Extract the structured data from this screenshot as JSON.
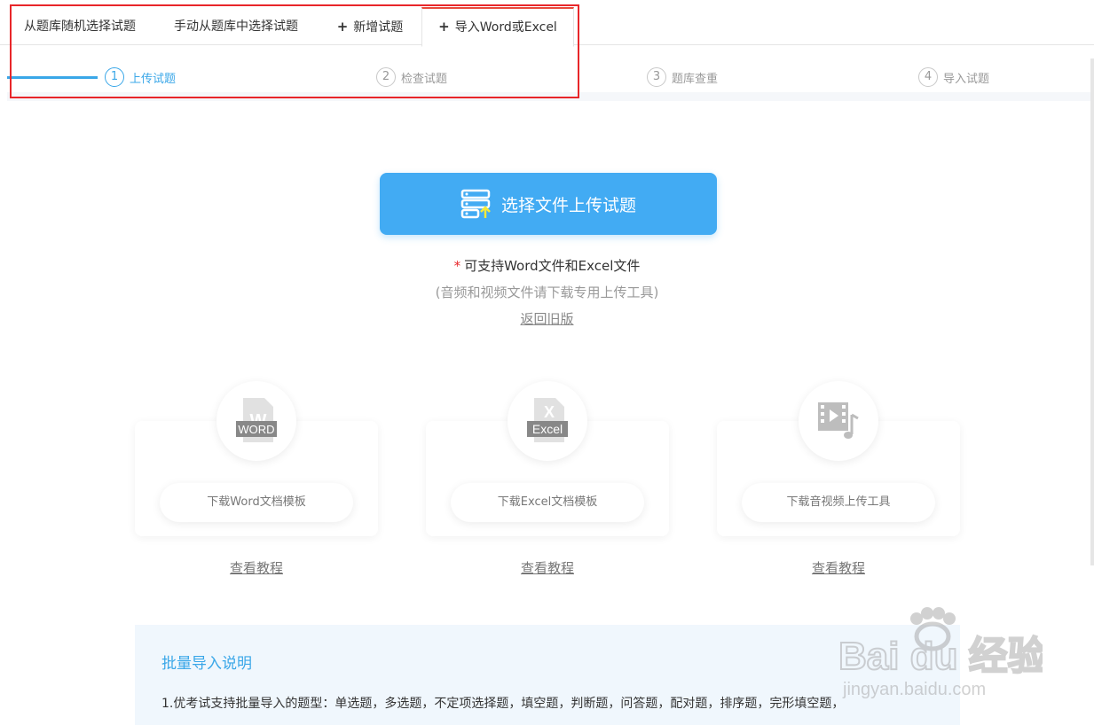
{
  "tabs": [
    {
      "label": "从题库随机选择试题",
      "plus": ""
    },
    {
      "label": "手动从题库中选择试题",
      "plus": ""
    },
    {
      "label": "新增试题",
      "plus": "+"
    },
    {
      "label": "导入Word或Excel",
      "plus": "+"
    }
  ],
  "steps": [
    {
      "num": "1",
      "label": "上传试题"
    },
    {
      "num": "2",
      "label": "检查试题"
    },
    {
      "num": "3",
      "label": "题库查重"
    },
    {
      "num": "4",
      "label": "导入试题"
    }
  ],
  "upload": {
    "label": "选择文件上传试题"
  },
  "notes": {
    "star": "*",
    "support": "可支持Word文件和Excel文件",
    "av": "(音频和视频文件请下载专用上传工具)",
    "back": "返回旧版"
  },
  "cards": [
    {
      "icon_text": "WORD",
      "button": "下载Word文档模板",
      "link": "查看教程"
    },
    {
      "icon_text": "Excel",
      "button": "下载Excel文档模板",
      "link": "查看教程"
    },
    {
      "icon_text": "",
      "button": "下载音视频上传工具",
      "link": "查看教程"
    }
  ],
  "info": {
    "title": "批量导入说明",
    "line1": "1.优考试支持批量导入的题型：单选题，多选题，不定项选择题，填空题，判断题，问答题，配对题，排序题，完形填空题，"
  },
  "watermark": {
    "brand": "Bai du 经验",
    "url": "jingyan.baidu.com"
  },
  "colors": {
    "accent": "#3aa7e8",
    "button": "#42abf3",
    "highlight": "#e8262a"
  }
}
